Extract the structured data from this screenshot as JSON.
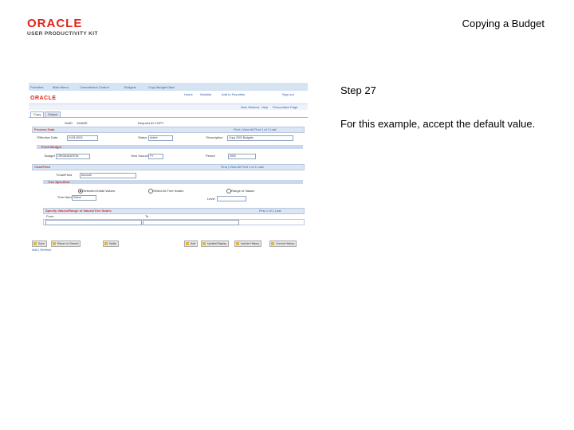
{
  "branding": {
    "logo_text": "ORACLE",
    "logo_subtext": "USER PRODUCTIVITY KIT"
  },
  "doc_title": "Copying a Budget",
  "step": {
    "number": "Step 27",
    "text": "For this example, accept the default value."
  },
  "app": {
    "nav_links": [
      "Favorites",
      "Main Menu",
      "Commitment Control",
      "Budgets",
      "Copy Budget Data"
    ],
    "header_links": [
      "Home",
      "Worklist",
      "Add to Favorites",
      "Sign out"
    ],
    "brand": "ORACLE",
    "strip_links": [
      "New Window",
      "Help",
      "Personalize Page"
    ],
    "tabs": [
      "Copy",
      "Output"
    ],
    "setid_label": "SetID",
    "setid_value": "SHARE",
    "request_label": "Request ID",
    "request_value": "COPY",
    "process_section": "Process Data",
    "find_nav": "Find | View All    First  1 of 1  Last",
    "eff_date_label": "*Effective Date",
    "eff_date_value": "01/01/2002",
    "status_label": "Status",
    "status_value": "Active",
    "descr_label": "*Description",
    "descr_value": "Copy 2002 Budgets",
    "from_section": "From Budget",
    "budget_label": "Budget",
    "budget_value": "ORGANIZATION",
    "year_label": "Year Source",
    "year_value": "FY",
    "period_label": "Period",
    "period_value": "2002",
    "chart_section": "ChartField",
    "cf_find": "Find | View All    First  1 of 1  Last",
    "cf_label": "*ChartField",
    "cf_value": "Account",
    "tree_section": "Tree Specified",
    "radio_1": "Selected Detail Values",
    "radio_2": "Select All Tree Nodes",
    "radio_3": "Range of Values",
    "tree_label": "Tree Name",
    "tree_value": "Select",
    "tree_level_label": "Level",
    "grid_title": "Specify Values/Range of Values/Tree Nodes",
    "grid_nav": "First  1 of 1  Last",
    "grid_col_1": "From",
    "grid_col_2": "To",
    "buttons": [
      "Save",
      "Return to Search",
      "Notify",
      "Add",
      "Update/Display",
      "Include History",
      "Correct History"
    ],
    "footer_link": "Add | Refresh"
  }
}
